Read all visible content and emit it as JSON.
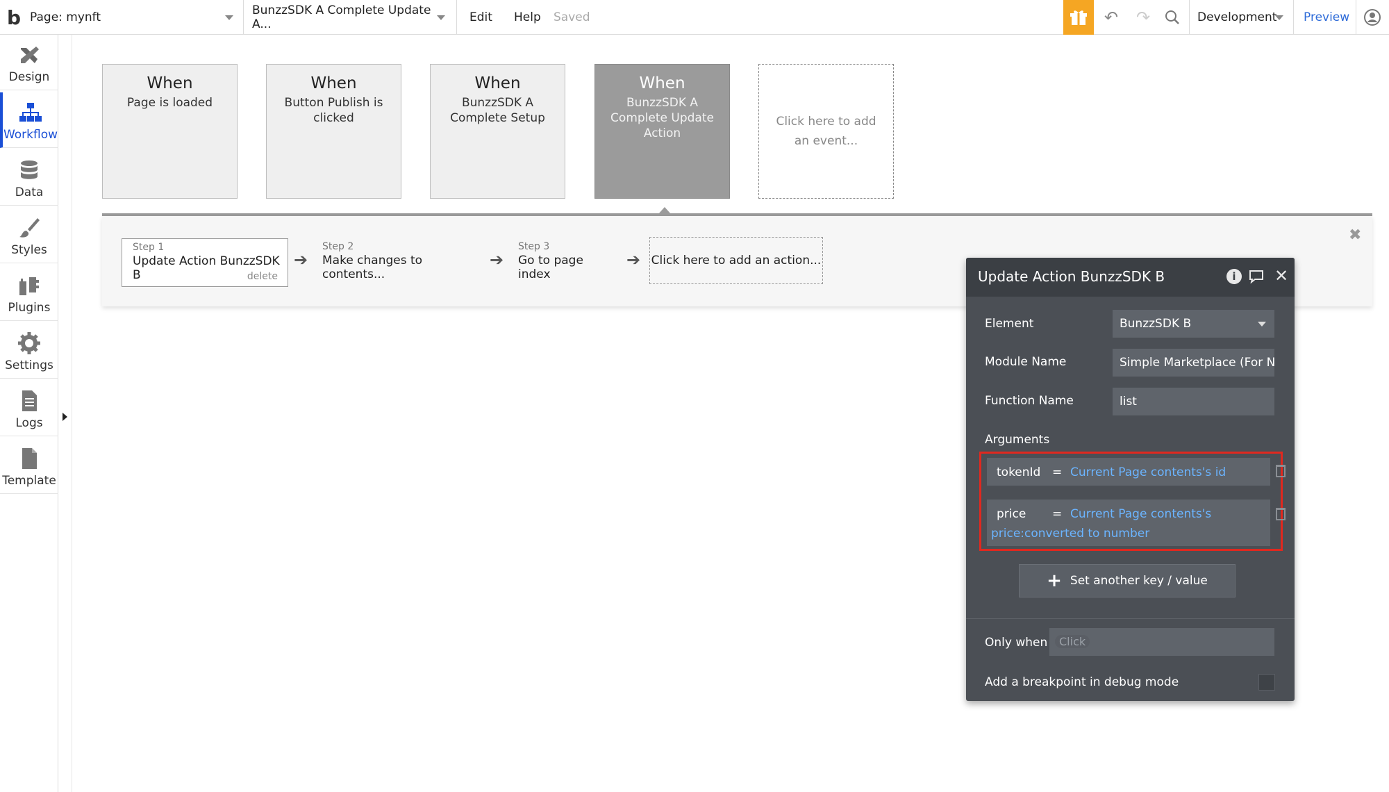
{
  "topbar": {
    "logo": "b",
    "page_label": "Page: mynft",
    "workflow_label": "BunzzSDK A Complete Update A...",
    "edit": "Edit",
    "help": "Help",
    "saved": "Saved",
    "environment": "Development",
    "preview": "Preview"
  },
  "sidebar": {
    "items": [
      {
        "label": "Design",
        "icon": "design-icon"
      },
      {
        "label": "Workflow",
        "icon": "workflow-icon",
        "active": true
      },
      {
        "label": "Data",
        "icon": "data-icon"
      },
      {
        "label": "Styles",
        "icon": "styles-icon"
      },
      {
        "label": "Plugins",
        "icon": "plugins-icon"
      },
      {
        "label": "Settings",
        "icon": "settings-icon"
      },
      {
        "label": "Logs",
        "icon": "logs-icon"
      },
      {
        "label": "Template",
        "icon": "template-icon"
      }
    ]
  },
  "events": [
    {
      "when": "When",
      "desc": "Page is loaded"
    },
    {
      "when": "When",
      "desc": "Button Publish is clicked"
    },
    {
      "when": "When",
      "desc": "BunzzSDK A Complete Setup"
    },
    {
      "when": "When",
      "desc": "BunzzSDK A Complete Update Action",
      "selected": true
    }
  ],
  "add_event": "Click here to add an event...",
  "steps": [
    {
      "num": "Step 1",
      "title": "Update Action BunzzSDK B",
      "delete": "delete"
    },
    {
      "num": "Step 2",
      "title": "Make changes to contents..."
    },
    {
      "num": "Step 3",
      "title": "Go to page index"
    }
  ],
  "add_action": "Click here to add an action...",
  "panel": {
    "title": "Update Action BunzzSDK B",
    "element_label": "Element",
    "element_value": "BunzzSDK B",
    "module_label": "Module Name",
    "module_value": "Simple Marketplace (For NFT",
    "function_label": "Function Name",
    "function_value": "list",
    "arguments_label": "Arguments",
    "args": [
      {
        "key": "tokenId",
        "eq": "=",
        "value": "Current Page contents's id"
      },
      {
        "key": "price",
        "eq": "=",
        "value": "Current Page contents's",
        "value2": "price:converted to number"
      }
    ],
    "set_kv": "Set another key / value",
    "only_when_label": "Only when",
    "only_when_placeholder": "Click",
    "breakpoint_label": "Add a breakpoint in debug mode"
  },
  "colors": {
    "accent": "#1a4fd6",
    "gift": "#f5a623",
    "highlight_border": "#e0281f",
    "dynamic_text": "#6bb4ff",
    "panel_bg": "#4b4f55"
  }
}
